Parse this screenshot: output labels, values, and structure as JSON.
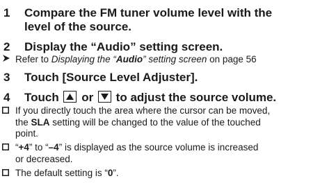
{
  "steps": [
    {
      "number": "1",
      "title_line1": "Compare the FM tuner volume level with the",
      "title_line2": "level of the source."
    },
    {
      "number": "2",
      "title": "Display the “Audio” setting screen."
    },
    {
      "number": "3",
      "title": "Touch [Source Level Adjuster]."
    },
    {
      "number": "4",
      "title_before": "Touch",
      "title_or": "or",
      "title_after": "to adjust the source volume."
    }
  ],
  "ref": {
    "prefix": "Refer to ",
    "link_pre": "Displaying the “",
    "link_bold": "Audio",
    "link_post": "” setting screen",
    "suffix": " on page 56"
  },
  "notes": {
    "n1_l1": "If you directly touch the area where the cursor can be moved,",
    "n1_l2_pre": "the ",
    "n1_l2_bold": "SLA",
    "n1_l2_post": " setting will be changed to the value of the touched",
    "n1_l3": "point.",
    "n2_q1": "“",
    "n2_b1": "+4",
    "n2_mid": "” to “",
    "n2_b2": "–4",
    "n2_post": "” is displayed as the source volume is increased",
    "n2_l2": "or decreased.",
    "n3_pre": "The default setting is “",
    "n3_bold": "0",
    "n3_post": "”."
  },
  "icons": {
    "reference": "arrow-right-icon",
    "note": "checkbox-icon",
    "up": "triangle-up-icon",
    "down": "triangle-down-icon"
  }
}
